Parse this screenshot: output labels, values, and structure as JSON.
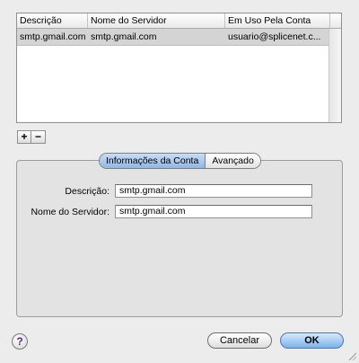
{
  "table": {
    "columns": [
      "Descrição",
      "Nome do Servidor",
      "Em Uso Pela Conta"
    ],
    "rows": [
      [
        "smtp.gmail.com",
        "smtp.gmail.com",
        "usuario@splicenet.c..."
      ]
    ]
  },
  "buttons": {
    "add": "+",
    "remove": "−",
    "cancel": "Cancelar",
    "ok": "OK",
    "help": "?"
  },
  "tabs": [
    {
      "label": "Informações da Conta",
      "active": true
    },
    {
      "label": "Avançado",
      "active": false
    }
  ],
  "form": {
    "description_label": "Descrição:",
    "description_value": "smtp.gmail.com",
    "server_label": "Nome do Servidor:",
    "server_value": "smtp.gmail.com"
  }
}
